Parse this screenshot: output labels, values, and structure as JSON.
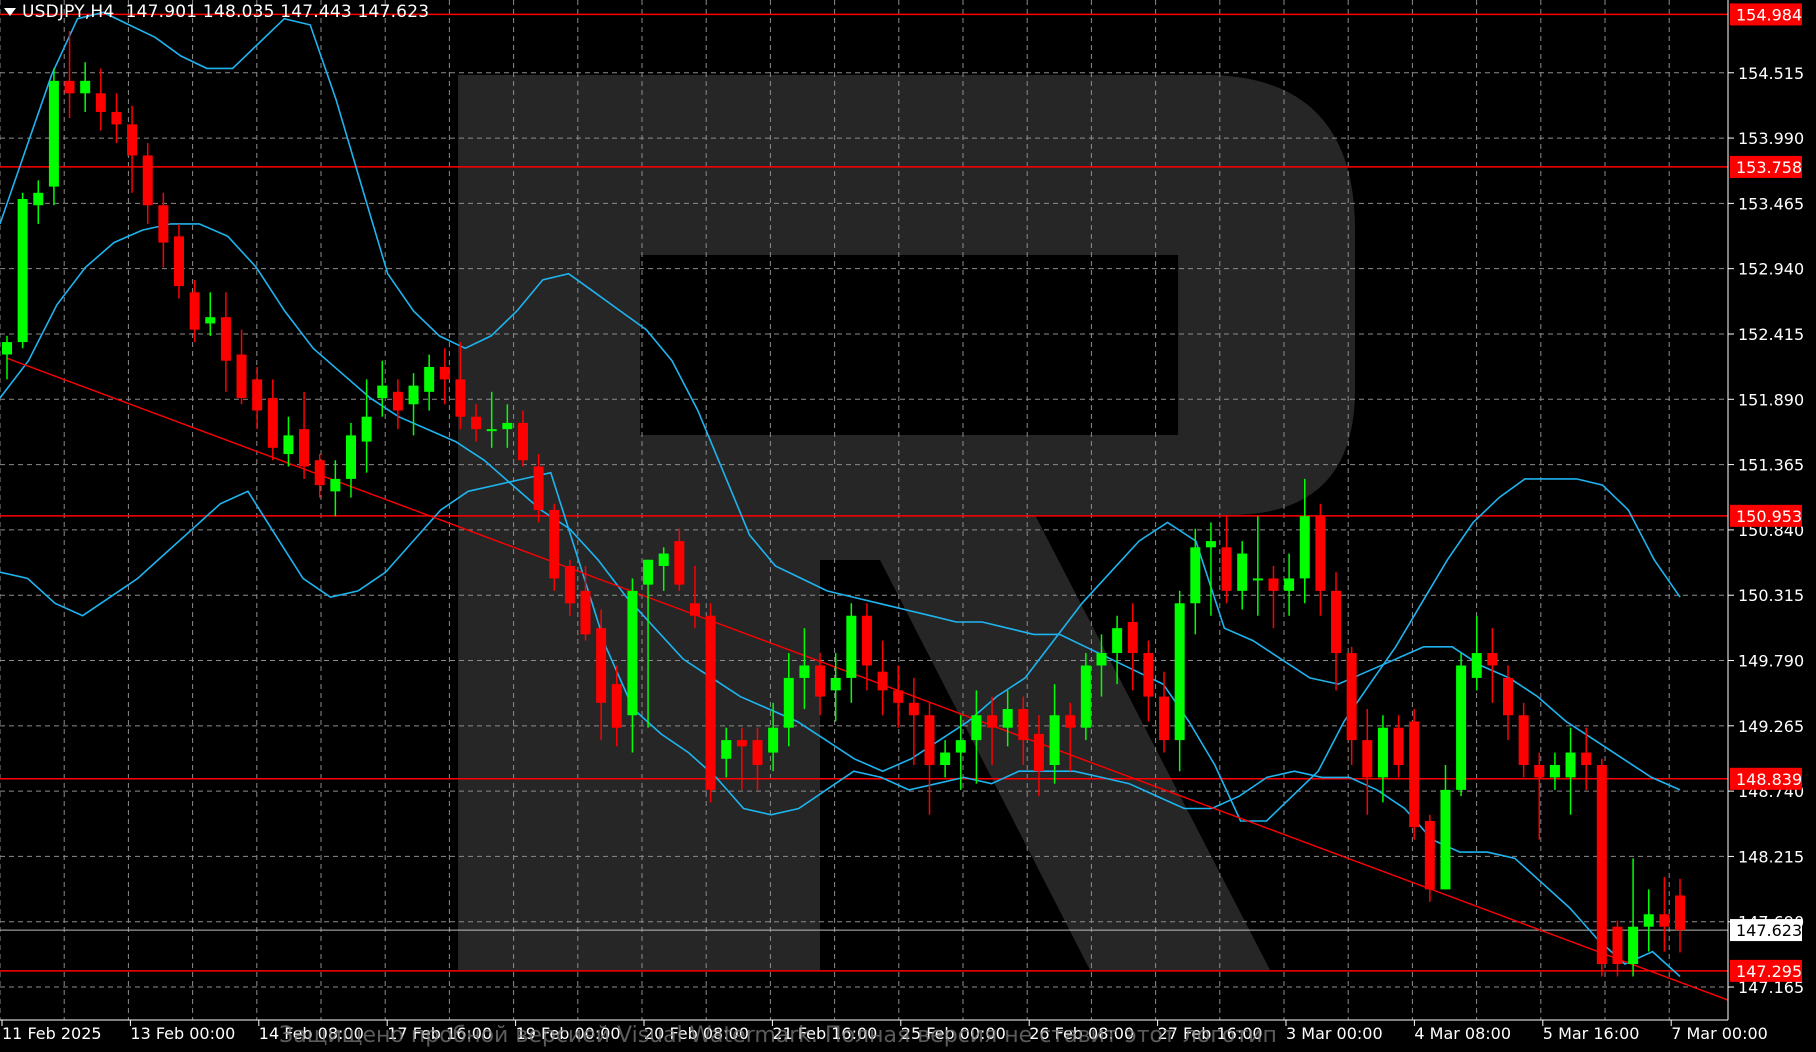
{
  "header": {
    "symbol": "USDJPY,H4",
    "ohlc": "147.901 148.035 147.443 147.623"
  },
  "watermark_text": "Защищено пробной версией Visual Watermark. Полная версия не ставит этот логотип",
  "colors": {
    "background": "#000000",
    "grid": "#8c8c8c",
    "bull": "#00ff00",
    "bear": "#ff0000",
    "bands": "#1eb4f0",
    "level": "#ff0000",
    "logo": "#282828"
  },
  "chart_data": {
    "type": "candlestick",
    "symbol": "USDJPY",
    "timeframe": "H4",
    "ylim": [
      146.9,
      155.1
    ],
    "y_ticks": [
      "154.515",
      "153.990",
      "153.465",
      "152.940",
      "152.415",
      "151.890",
      "151.365",
      "150.840",
      "150.315",
      "149.790",
      "149.265",
      "148.740",
      "148.215",
      "147.690",
      "147.165"
    ],
    "x_labels": [
      "11 Feb 2025",
      "13 Feb 00:00",
      "14 Feb 08:00",
      "17 Feb 16:00",
      "19 Feb 00:00",
      "20 Feb 08:00",
      "21 Feb 16:00",
      "25 Feb 00:00",
      "26 Feb 08:00",
      "27 Feb 16:00",
      "3 Mar 00:00",
      "4 Mar 08:00",
      "5 Mar 16:00",
      "7 Mar 00:00"
    ],
    "price_levels": [
      "154.984",
      "153.758",
      "150.953",
      "148.839",
      "147.295"
    ],
    "current_price": "147.623",
    "trendline": {
      "start": [
        0,
        152.22
      ],
      "end": [
        112,
        146.97
      ]
    },
    "bollinger": {
      "upper": [
        153.3,
        153.9,
        154.5,
        154.95,
        155.0,
        154.9,
        154.8,
        154.65,
        154.55,
        154.55,
        154.75,
        154.95,
        154.9,
        154.3,
        153.6,
        152.9,
        152.6,
        152.4,
        152.3,
        152.4,
        152.6,
        152.85,
        152.9,
        152.75,
        152.6,
        152.45,
        152.2,
        151.8,
        151.3,
        150.8,
        150.55,
        150.45,
        150.35,
        150.3,
        150.25,
        150.2,
        150.15,
        150.1,
        150.1,
        150.05,
        150.0,
        150.0,
        149.9,
        149.8,
        149.7,
        149.6,
        149.3,
        148.95,
        148.5,
        148.5,
        148.7,
        148.9,
        149.3,
        149.6,
        149.9,
        150.25,
        150.6,
        150.9,
        151.1,
        151.25,
        151.25,
        151.25,
        151.2,
        151.0,
        150.6,
        150.3
      ],
      "middle": [
        151.9,
        152.2,
        152.65,
        152.95,
        153.15,
        153.25,
        153.3,
        153.3,
        153.2,
        152.95,
        152.6,
        152.3,
        152.1,
        151.9,
        151.75,
        151.65,
        151.55,
        151.4,
        151.2,
        151.0,
        150.85,
        150.6,
        150.3,
        150.05,
        149.8,
        149.65,
        149.5,
        149.4,
        149.3,
        149.15,
        149.0,
        148.9,
        149.0,
        149.15,
        149.3,
        149.5,
        149.65,
        149.95,
        150.25,
        150.5,
        150.75,
        150.9,
        150.75,
        150.05,
        149.95,
        149.8,
        149.65,
        149.6,
        149.7,
        149.8,
        149.9,
        149.9,
        149.75,
        149.65,
        149.5,
        149.3,
        149.15,
        149.0,
        148.85,
        148.75
      ],
      "lower": [
        150.5,
        150.45,
        150.25,
        150.15,
        150.3,
        150.45,
        150.65,
        150.85,
        151.05,
        151.15,
        150.8,
        150.45,
        150.3,
        150.35,
        150.5,
        150.75,
        151.0,
        151.15,
        151.2,
        151.25,
        151.3,
        150.6,
        149.9,
        149.4,
        149.2,
        149.05,
        148.85,
        148.6,
        148.55,
        148.6,
        148.75,
        148.9,
        148.85,
        148.75,
        148.8,
        148.85,
        148.8,
        148.9,
        148.9,
        148.9,
        148.85,
        148.8,
        148.7,
        148.6,
        148.6,
        148.7,
        148.85,
        148.9,
        148.85,
        148.85,
        148.75,
        148.6,
        148.35,
        148.25,
        148.25,
        148.2,
        148.0,
        147.8,
        147.55,
        147.35,
        147.45,
        147.25
      ]
    },
    "candles": [
      [
        152.25,
        152.35,
        152.05,
        152.4
      ],
      [
        152.35,
        153.5,
        152.3,
        153.55
      ],
      [
        153.45,
        153.55,
        153.3,
        153.65
      ],
      [
        153.6,
        154.45,
        153.45,
        154.55
      ],
      [
        154.45,
        154.35,
        154.15,
        154.85
      ],
      [
        154.35,
        154.45,
        154.2,
        154.6
      ],
      [
        154.35,
        154.2,
        154.05,
        154.55
      ],
      [
        154.2,
        154.1,
        153.95,
        154.35
      ],
      [
        154.1,
        153.85,
        153.55,
        154.25
      ],
      [
        153.85,
        153.45,
        153.3,
        153.95
      ],
      [
        153.45,
        153.15,
        152.95,
        153.55
      ],
      [
        153.2,
        152.8,
        152.7,
        153.3
      ],
      [
        152.75,
        152.45,
        152.35,
        152.85
      ],
      [
        152.5,
        152.55,
        152.4,
        152.75
      ],
      [
        152.55,
        152.2,
        151.95,
        152.75
      ],
      [
        152.25,
        151.9,
        151.85,
        152.45
      ],
      [
        152.05,
        151.8,
        151.65,
        152.15
      ],
      [
        151.9,
        151.5,
        151.4,
        152.05
      ],
      [
        151.45,
        151.6,
        151.35,
        151.75
      ],
      [
        151.65,
        151.35,
        151.25,
        151.95
      ],
      [
        151.4,
        151.2,
        151.1,
        151.45
      ],
      [
        151.15,
        151.25,
        150.95,
        151.4
      ],
      [
        151.25,
        151.6,
        151.1,
        151.7
      ],
      [
        151.55,
        151.75,
        151.3,
        152.05
      ],
      [
        151.9,
        152.0,
        151.75,
        152.2
      ],
      [
        151.95,
        151.8,
        151.65,
        152.05
      ],
      [
        151.85,
        152.0,
        151.6,
        152.1
      ],
      [
        151.95,
        152.15,
        151.8,
        152.25
      ],
      [
        152.15,
        152.05,
        151.85,
        152.3
      ],
      [
        152.05,
        151.75,
        151.65,
        152.35
      ],
      [
        151.75,
        151.65,
        151.55,
        151.85
      ],
      [
        151.65,
        151.65,
        151.5,
        151.95
      ],
      [
        151.65,
        151.7,
        151.5,
        151.85
      ],
      [
        151.7,
        151.4,
        151.35,
        151.8
      ],
      [
        151.35,
        151.0,
        150.9,
        151.45
      ],
      [
        151.0,
        150.45,
        150.35,
        151.05
      ],
      [
        150.55,
        150.25,
        150.15,
        150.6
      ],
      [
        150.35,
        150.0,
        149.95,
        150.55
      ],
      [
        150.05,
        149.45,
        149.15,
        150.2
      ],
      [
        149.6,
        149.25,
        149.1,
        149.75
      ],
      [
        149.35,
        150.35,
        149.05,
        150.45
      ],
      [
        150.4,
        150.6,
        149.25,
        150.6
      ],
      [
        150.55,
        150.65,
        150.35,
        150.7
      ],
      [
        150.75,
        150.4,
        150.35,
        150.85
      ],
      [
        150.25,
        150.15,
        150.05,
        150.55
      ],
      [
        150.15,
        148.75,
        148.65,
        150.25
      ],
      [
        149.0,
        149.15,
        148.85,
        149.25
      ],
      [
        149.15,
        149.1,
        148.75,
        149.25
      ],
      [
        149.15,
        148.95,
        148.75,
        149.25
      ],
      [
        149.05,
        149.25,
        148.9,
        149.45
      ],
      [
        149.25,
        149.65,
        149.1,
        149.85
      ],
      [
        149.65,
        149.75,
        149.4,
        150.05
      ],
      [
        149.75,
        149.5,
        149.35,
        149.85
      ],
      [
        149.55,
        149.65,
        149.3,
        149.85
      ],
      [
        149.65,
        150.15,
        149.45,
        150.25
      ],
      [
        150.15,
        149.75,
        149.55,
        150.25
      ],
      [
        149.7,
        149.55,
        149.35,
        149.95
      ],
      [
        149.55,
        149.45,
        149.25,
        149.75
      ],
      [
        149.45,
        149.35,
        148.95,
        149.65
      ],
      [
        149.35,
        148.95,
        148.55,
        149.45
      ],
      [
        148.95,
        149.05,
        148.85,
        149.15
      ],
      [
        149.05,
        149.15,
        148.75,
        149.35
      ],
      [
        149.15,
        149.35,
        148.8,
        149.55
      ],
      [
        149.35,
        149.25,
        148.95,
        149.5
      ],
      [
        149.25,
        149.4,
        149.1,
        149.55
      ],
      [
        149.4,
        149.15,
        148.95,
        149.5
      ],
      [
        149.2,
        148.9,
        148.7,
        149.35
      ],
      [
        148.95,
        149.35,
        148.8,
        149.6
      ],
      [
        149.35,
        149.25,
        148.9,
        149.45
      ],
      [
        149.25,
        149.75,
        149.15,
        149.85
      ],
      [
        149.75,
        149.85,
        149.5,
        150.0
      ],
      [
        149.85,
        150.05,
        149.6,
        150.15
      ],
      [
        150.1,
        149.85,
        149.55,
        150.25
      ],
      [
        149.85,
        149.5,
        149.3,
        149.95
      ],
      [
        149.5,
        149.15,
        149.05,
        149.7
      ],
      [
        149.15,
        150.25,
        148.9,
        150.35
      ],
      [
        150.25,
        150.7,
        150.0,
        150.85
      ],
      [
        150.7,
        150.75,
        150.15,
        150.9
      ],
      [
        150.7,
        150.35,
        150.25,
        150.95
      ],
      [
        150.35,
        150.65,
        150.2,
        150.75
      ],
      [
        150.45,
        150.45,
        150.15,
        150.95
      ],
      [
        150.45,
        150.35,
        150.05,
        150.55
      ],
      [
        150.35,
        150.45,
        150.15,
        150.65
      ],
      [
        150.45,
        150.95,
        150.25,
        151.25
      ],
      [
        150.95,
        150.35,
        150.15,
        151.05
      ],
      [
        150.35,
        149.85,
        149.55,
        150.5
      ],
      [
        149.85,
        149.15,
        148.95,
        149.9
      ],
      [
        149.15,
        148.85,
        148.55,
        149.4
      ],
      [
        148.85,
        149.25,
        148.65,
        149.35
      ],
      [
        149.25,
        148.95,
        148.85,
        149.35
      ],
      [
        149.3,
        148.45,
        148.35,
        149.4
      ],
      [
        148.5,
        147.95,
        147.85,
        148.55
      ],
      [
        147.95,
        148.75,
        147.95,
        148.95
      ],
      [
        148.75,
        149.75,
        148.7,
        149.85
      ],
      [
        149.65,
        149.85,
        149.55,
        150.15
      ],
      [
        149.85,
        149.75,
        149.45,
        150.05
      ],
      [
        149.65,
        149.35,
        149.15,
        149.75
      ],
      [
        149.35,
        148.95,
        148.85,
        149.45
      ],
      [
        148.95,
        148.85,
        148.35,
        149.05
      ],
      [
        148.85,
        148.95,
        148.75,
        149.05
      ],
      [
        148.85,
        149.05,
        148.55,
        149.25
      ],
      [
        149.05,
        148.95,
        148.75,
        149.25
      ],
      [
        148.95,
        147.35,
        147.25,
        149.0
      ],
      [
        147.65,
        147.35,
        147.25,
        147.7
      ],
      [
        147.35,
        147.65,
        147.25,
        148.2
      ],
      [
        147.65,
        147.75,
        147.45,
        147.95
      ],
      [
        147.75,
        147.65,
        147.45,
        148.05
      ],
      [
        147.901,
        147.623,
        147.443,
        148.035
      ]
    ]
  }
}
